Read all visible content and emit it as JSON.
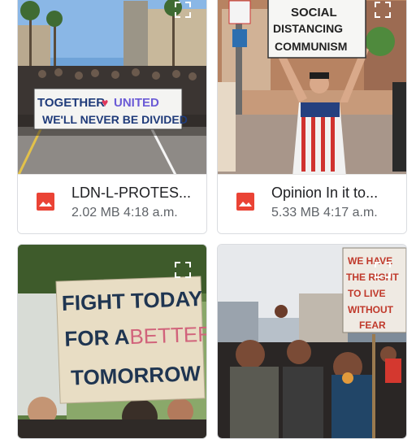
{
  "files": [
    {
      "name": "LDN-L-PROTES...",
      "size": "2.02 MB",
      "time": "4:18 a.m.",
      "sign_line1": "TOGETHER",
      "sign_united": "UNITED",
      "sign_line2": "WE'LL NEVER BE DIVIDED"
    },
    {
      "name": "Opinion In it to...",
      "size": "5.33 MB",
      "time": "4:17 a.m.",
      "sign_line1": "SOCIAL",
      "sign_line2": "DISTANCING",
      "sign_line3": "COMMUNISM"
    },
    {
      "sign_line1": "FIGHT TODAY",
      "sign_line2": "FOR A",
      "sign_better": "BETTER",
      "sign_line3": "TOMORROW"
    },
    {
      "sign_line1": "WE HAVE",
      "sign_line2": "THE RIGHT",
      "sign_line3": "TO LIVE",
      "sign_line4": "WITHOUT",
      "sign_line5": "FEAR"
    }
  ],
  "colors": {
    "image_icon": "#ea4335",
    "border": "#dadce0"
  },
  "icons": {
    "file_type": "image-file-icon",
    "expand": "expand-icon"
  }
}
